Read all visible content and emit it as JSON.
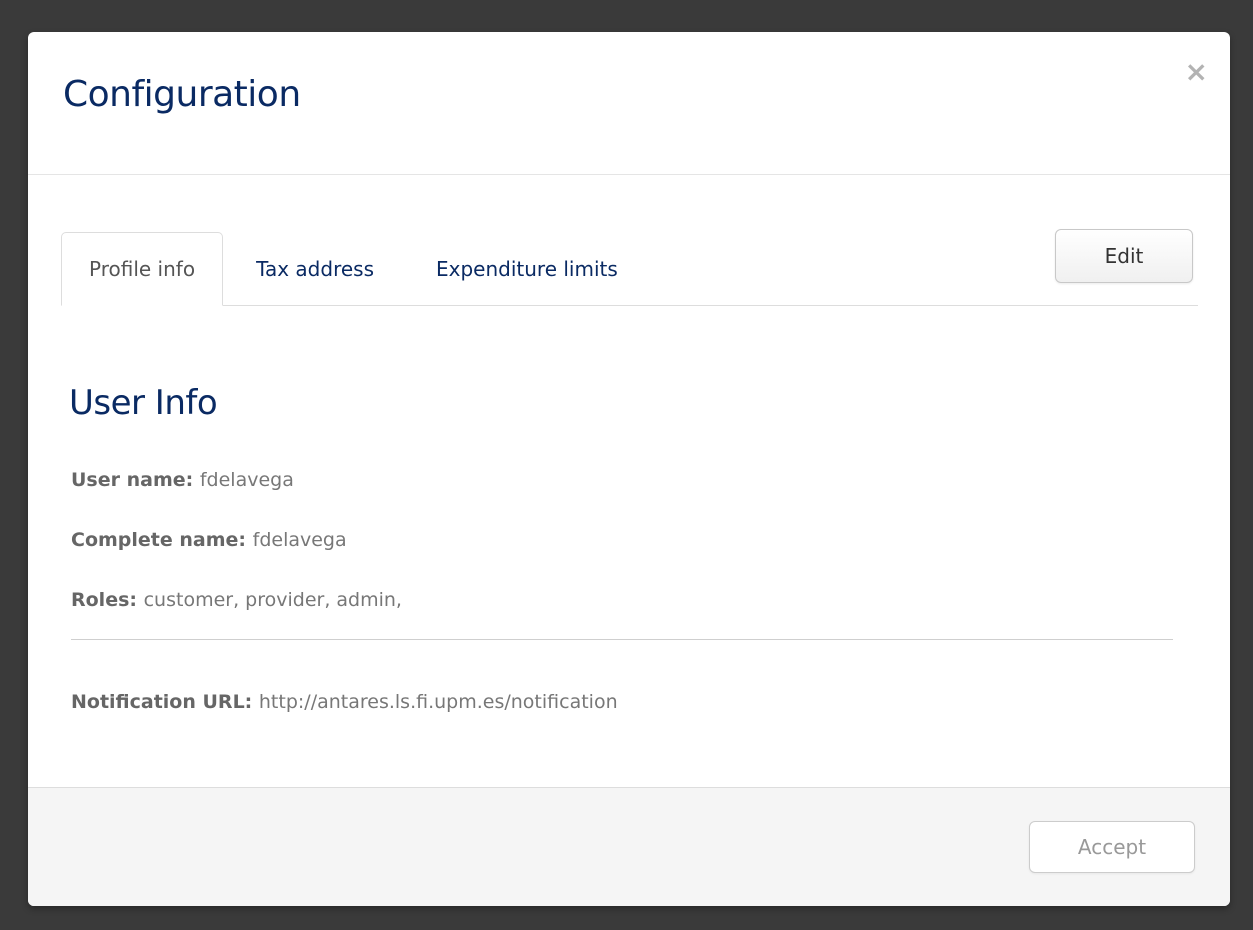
{
  "modal": {
    "title": "Configuration",
    "close_symbol": "×"
  },
  "tabs": [
    {
      "label": "Profile info",
      "active": true
    },
    {
      "label": "Tax address",
      "active": false
    },
    {
      "label": "Expenditure limits",
      "active": false
    }
  ],
  "actions": {
    "edit_label": "Edit",
    "accept_label": "Accept"
  },
  "user_info": {
    "section_title": "User Info",
    "user_name_label": "User name:",
    "user_name_value": "fdelavega",
    "complete_name_label": "Complete name:",
    "complete_name_value": "fdelavega",
    "roles_label": "Roles:",
    "roles_value": "customer, provider, admin,",
    "notification_url_label": "Notification URL:",
    "notification_url_value": "http://antares.ls.fi.upm.es/notification"
  },
  "colors": {
    "backdrop": "#3a3a3a",
    "title_blue": "#0a2a63",
    "text_gray": "#777777",
    "footer_bg": "#f5f5f5"
  },
  "icons": {
    "close": "close-icon"
  }
}
